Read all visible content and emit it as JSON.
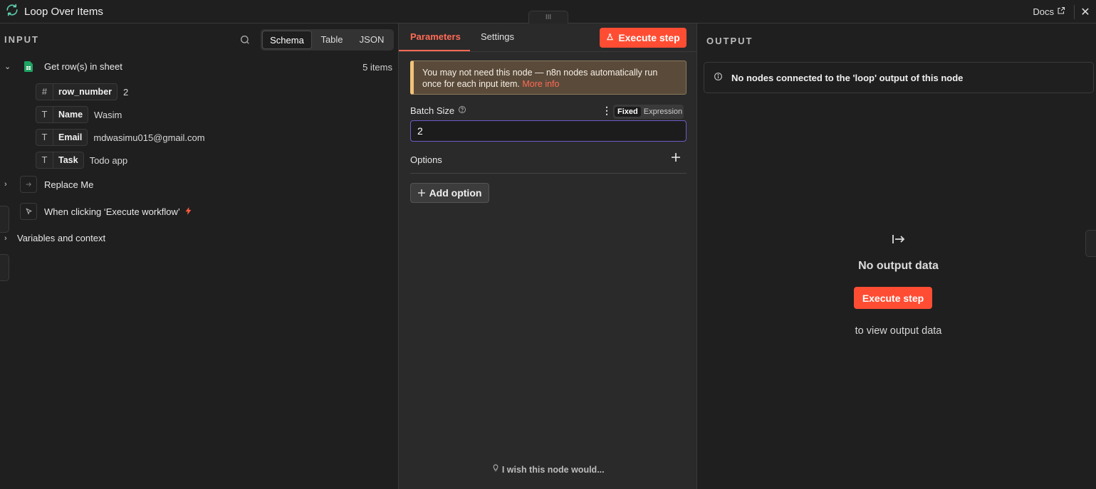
{
  "header": {
    "title": "Loop Over Items",
    "docs_label": "Docs",
    "close_glyph": "✕",
    "handle_glyph": "III"
  },
  "input": {
    "label": "INPUT",
    "view_tabs": [
      "Schema",
      "Table",
      "JSON"
    ],
    "active_view": "Schema",
    "nodes": [
      {
        "name": "Get row(s) in sheet",
        "count": "5 items",
        "expanded": true,
        "icon": "google-sheets-icon",
        "fields": [
          {
            "type": "#",
            "key": "row_number",
            "value": "2"
          },
          {
            "type": "T",
            "key": "Name",
            "value": "Wasim"
          },
          {
            "type": "T",
            "key": "Email",
            "value": "mdwasimu015@gmail.com"
          },
          {
            "type": "T",
            "key": "Task",
            "value": "Todo app"
          }
        ]
      },
      {
        "name": "Replace Me",
        "icon": "arrow-right-icon"
      },
      {
        "name": "When clicking ‘Execute workflow’",
        "icon": "cursor-click-icon",
        "trigger_icon": "lightning-icon"
      }
    ],
    "variables_label": "Variables and context"
  },
  "params": {
    "tabs": [
      "Parameters",
      "Settings"
    ],
    "active_tab": "Parameters",
    "execute_label": "Execute step",
    "notice_text": "You may not need this node — n8n nodes automatically run once for each input item.",
    "notice_link": "More info",
    "batch_size_label": "Batch Size",
    "mode_options": [
      "Fixed",
      "Expression"
    ],
    "active_mode": "Fixed",
    "batch_size_value": "2",
    "options_label": "Options",
    "add_option_label": "Add option",
    "wish_label": "I wish this node would..."
  },
  "output": {
    "label": "OUTPUT",
    "info_text": "No nodes connected to the 'loop' output of this node",
    "no_output_label": "No output data",
    "execute_label": "Execute step",
    "to_view_label": "to view output data"
  },
  "colors": {
    "accent": "#ff4d33",
    "tab_active": "#ff6b55",
    "input_border": "#6b5cc8",
    "sheets_green": "#1fa463",
    "notice_bg": "#5a4a3a"
  }
}
